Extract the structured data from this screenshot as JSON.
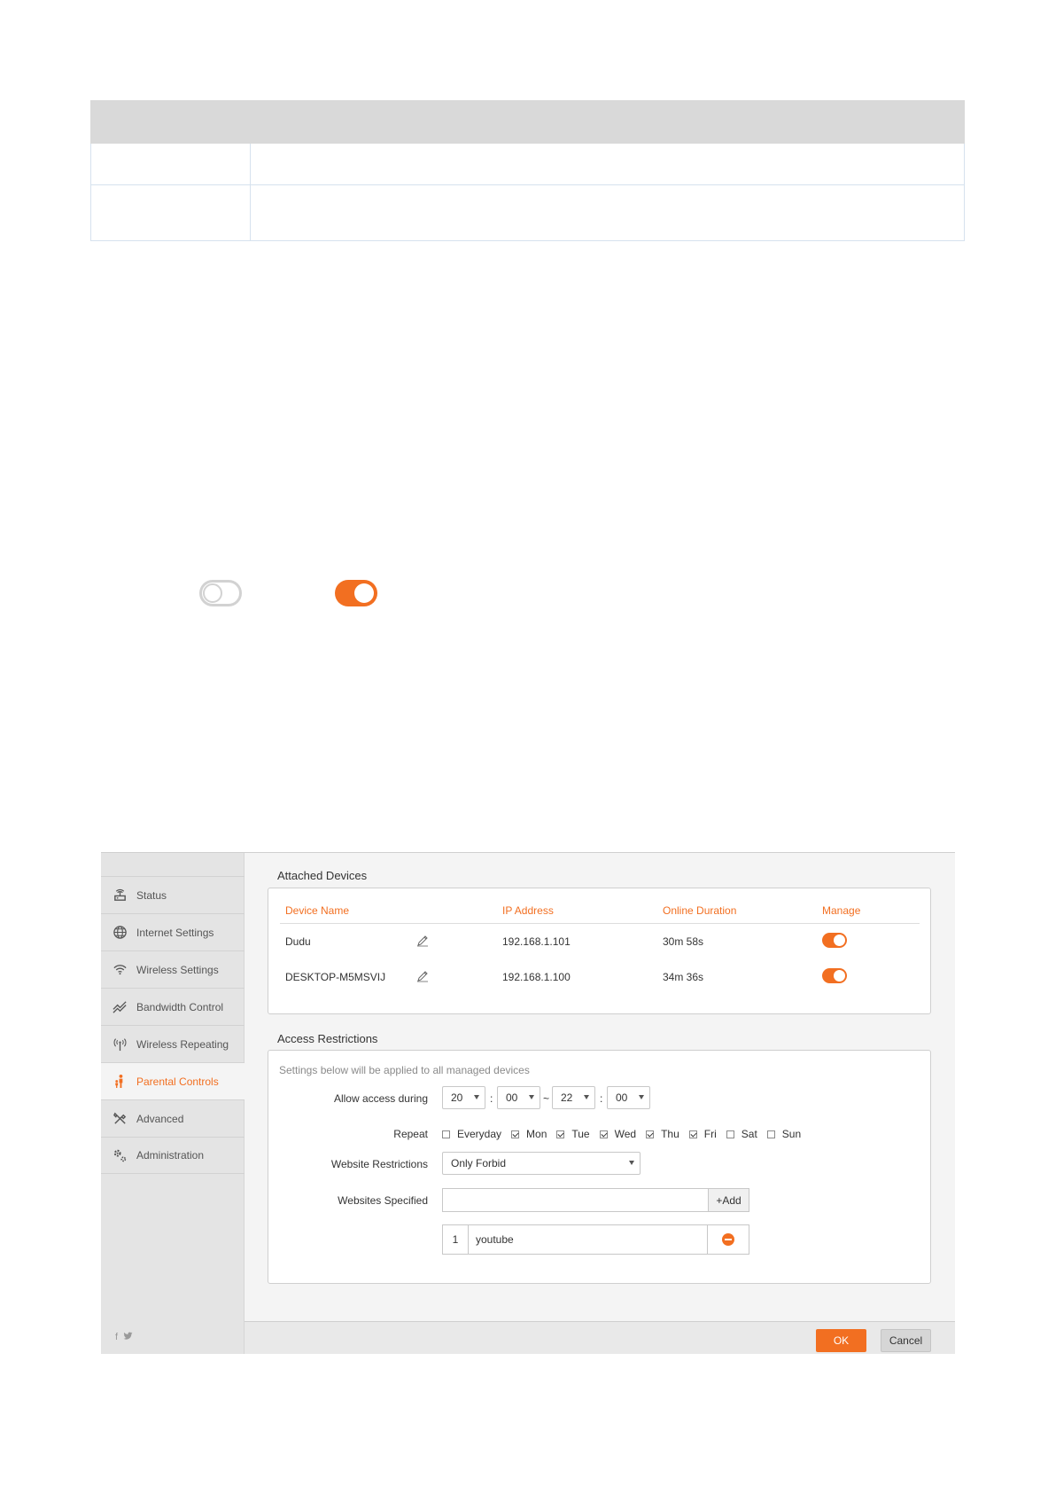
{
  "router_ui": {
    "sidebar": {
      "items": [
        {
          "label": "Status",
          "icon": "router-icon"
        },
        {
          "label": "Internet Settings",
          "icon": "globe-icon"
        },
        {
          "label": "Wireless Settings",
          "icon": "wifi-icon"
        },
        {
          "label": "Bandwidth Control",
          "icon": "bandwidth-icon"
        },
        {
          "label": "Wireless Repeating",
          "icon": "antenna-icon"
        },
        {
          "label": "Parental Controls",
          "icon": "parent-child-icon",
          "active": true
        },
        {
          "label": "Advanced",
          "icon": "tools-icon"
        },
        {
          "label": "Administration",
          "icon": "gears-icon"
        }
      ],
      "social": {
        "facebook": "f",
        "twitter": "twitter-bird"
      }
    },
    "attached_devices": {
      "title": "Attached Devices",
      "columns": [
        "Device Name",
        "IP Address",
        "Online Duration",
        "Manage"
      ],
      "rows": [
        {
          "name": "Dudu",
          "ip": "192.168.1.101",
          "duration": "30m 58s",
          "manage": true
        },
        {
          "name": "DESKTOP-M5MSVIJ",
          "ip": "192.168.1.100",
          "duration": "34m 36s",
          "manage": true
        }
      ]
    },
    "access_restrictions": {
      "title": "Access Restrictions",
      "hint": "Settings below will be applied to all managed devices",
      "allow_access_label": "Allow access during",
      "start_hour": "20",
      "start_minute": "00",
      "time_sep": ":",
      "range_sep": "~",
      "end_hour": "22",
      "end_minute": "00",
      "repeat_label": "Repeat",
      "days": [
        {
          "label": "Everyday",
          "checked": false
        },
        {
          "label": "Mon",
          "checked": true
        },
        {
          "label": "Tue",
          "checked": true
        },
        {
          "label": "Wed",
          "checked": true
        },
        {
          "label": "Thu",
          "checked": true
        },
        {
          "label": "Fri",
          "checked": true
        },
        {
          "label": "Sat",
          "checked": false
        },
        {
          "label": "Sun",
          "checked": false
        }
      ],
      "website_restrictions_label": "Website Restrictions",
      "website_restrictions_value": "Only Forbid",
      "websites_specified_label": "Websites Specified",
      "website_input_value": "",
      "add_label": "+Add",
      "websites": [
        {
          "index": "1",
          "value": "youtube"
        }
      ]
    },
    "footer": {
      "ok_label": "OK",
      "cancel_label": "Cancel"
    },
    "colors": {
      "accent": "#f26f21",
      "sidebar_bg": "#e4e4e4",
      "content_bg": "#f4f4f4"
    }
  },
  "switch_examples": {
    "off": false,
    "on": true
  }
}
